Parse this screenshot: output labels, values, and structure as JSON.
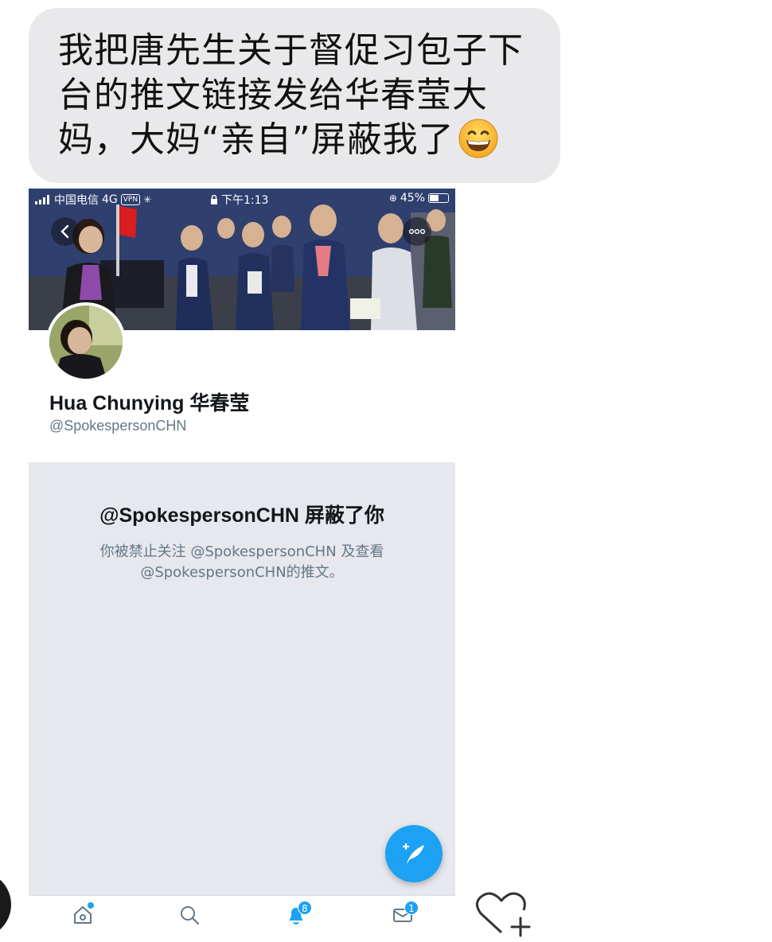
{
  "message": {
    "text_line1": "我把唐先生关于督促习包子下",
    "text_line2": "台的推文链接发给华春莹大",
    "text_line3": "妈，大妈“亲自”屏蔽我了",
    "emoji": "grinning-face-with-smiling-eyes"
  },
  "screenshot": {
    "status_bar": {
      "carrier": "中国电信",
      "network": "4G",
      "vpn": "VPN",
      "time": "下午1:13",
      "battery": "45%",
      "battery_level": 0.45
    },
    "profile": {
      "name": "Hua Chunying 华春莹",
      "handle": "@SpokespersonCHN"
    },
    "blocked_notice": {
      "title": "@SpokespersonCHN 屏蔽了你",
      "desc_line1": "你被禁止关注 @SpokespersonCHN 及查看",
      "desc_line2": "@SpokespersonCHN的推文。"
    },
    "tabbar": {
      "items": [
        {
          "name": "home",
          "icon": "home-icon",
          "badge": ""
        },
        {
          "name": "search",
          "icon": "search-icon",
          "badge": ""
        },
        {
          "name": "notifications",
          "icon": "bell-icon",
          "badge": "8"
        },
        {
          "name": "messages",
          "icon": "mail-icon",
          "badge": "1"
        }
      ]
    },
    "fab": {
      "icon": "compose-feather-icon"
    }
  },
  "colors": {
    "bubble": "#e9e9eb",
    "twitter_blue": "#1da1f2",
    "screenshot_bg": "#e6e8ee"
  }
}
